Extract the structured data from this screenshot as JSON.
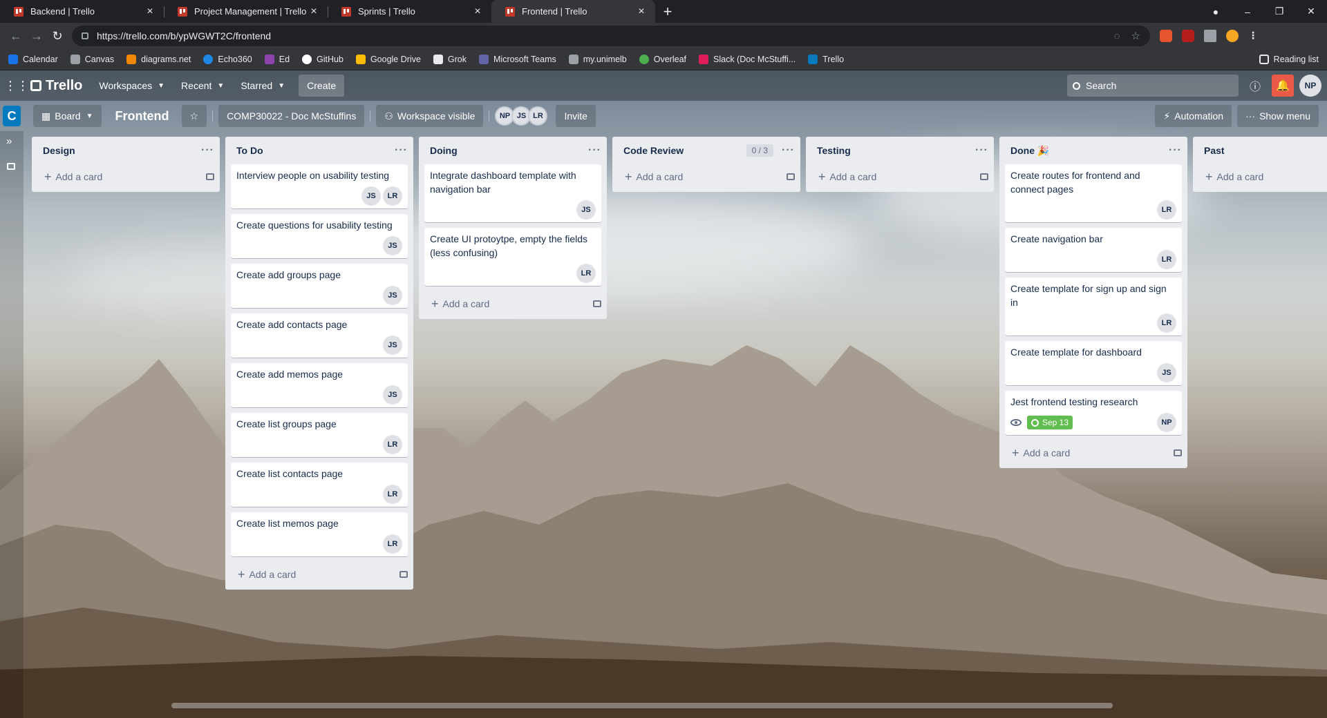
{
  "browser": {
    "tabs": [
      {
        "label": "Backend | Trello"
      },
      {
        "label": "Project Management | Trello"
      },
      {
        "label": "Sprints | Trello"
      },
      {
        "label": "Frontend | Trello"
      }
    ],
    "url": "https://trello.com/b/ypWGWT2C/frontend",
    "bookmarks": [
      {
        "label": "Calendar",
        "color": "#1a73e8"
      },
      {
        "label": "Canvas",
        "color": "#9aa0a6"
      },
      {
        "label": "diagrams.net",
        "color": "#f08705"
      },
      {
        "label": "Echo360",
        "color": "#1e88e5"
      },
      {
        "label": "Ed",
        "color": "#8e44ad"
      },
      {
        "label": "GitHub",
        "color": "#ffffff"
      },
      {
        "label": "Google Drive",
        "color": "#fbbc04"
      },
      {
        "label": "Grok",
        "color": "#e8eaed"
      },
      {
        "label": "Microsoft Teams",
        "color": "#6264a7"
      },
      {
        "label": "my.unimelb",
        "color": "#9aa0a6"
      },
      {
        "label": "Overleaf",
        "color": "#4cae4c"
      },
      {
        "label": "Slack (Doc McStuffi...",
        "color": "#e01e5a"
      },
      {
        "label": "Trello",
        "color": "#0079bf"
      }
    ],
    "reading_list": "Reading list"
  },
  "header": {
    "logo": "Trello",
    "menus": [
      "Workspaces",
      "Recent",
      "Starred"
    ],
    "create": "Create",
    "search_placeholder": "Search",
    "user_initials": "NP"
  },
  "board": {
    "workspace_badge": "C",
    "view": "Board",
    "title": "Frontend",
    "workspace": "COMP30022 - Doc McStuffins",
    "visibility": "Workspace visible",
    "members": [
      "NP",
      "JS",
      "LR"
    ],
    "invite": "Invite",
    "automation": "Automation",
    "show_menu": "Show menu"
  },
  "add_card_label": "Add a card",
  "lists": [
    {
      "name": "Design",
      "count": "",
      "cards": []
    },
    {
      "name": "To Do",
      "count": "",
      "cards": [
        {
          "title": "Interview people on usability testing",
          "members": [
            "JS",
            "LR"
          ]
        },
        {
          "title": "Create questions for usability testing",
          "members": [
            "JS"
          ]
        },
        {
          "title": "Create add groups page",
          "members": [
            "JS"
          ]
        },
        {
          "title": "Create add contacts page",
          "members": [
            "JS"
          ]
        },
        {
          "title": "Create add memos page",
          "members": [
            "JS"
          ]
        },
        {
          "title": "Create list groups page",
          "members": [
            "LR"
          ]
        },
        {
          "title": "Create list contacts page",
          "members": [
            "LR"
          ]
        },
        {
          "title": "Create list memos page",
          "members": [
            "LR"
          ]
        }
      ]
    },
    {
      "name": "Doing",
      "count": "",
      "cards": [
        {
          "title": "Integrate dashboard template with navigation bar",
          "members": [
            "JS"
          ]
        },
        {
          "title": "Create UI protoytpe, empty the fields (less confusing)",
          "members": [
            "LR"
          ]
        }
      ]
    },
    {
      "name": "Code Review",
      "count": "0 / 3",
      "cards": []
    },
    {
      "name": "Testing",
      "count": "",
      "cards": []
    },
    {
      "name": "Done 🎉",
      "count": "",
      "cards": [
        {
          "title": "Create routes for frontend and connect pages",
          "members": [
            "LR"
          ]
        },
        {
          "title": "Create navigation bar",
          "members": [
            "LR"
          ]
        },
        {
          "title": "Create template for sign up and sign in",
          "members": [
            "LR"
          ]
        },
        {
          "title": "Create template for dashboard",
          "members": [
            "JS"
          ]
        },
        {
          "title": "Jest frontend testing research",
          "members": [
            "NP"
          ],
          "watching": true,
          "due": "Sep 13"
        }
      ]
    },
    {
      "name": "Past",
      "count": "",
      "cards": []
    }
  ]
}
